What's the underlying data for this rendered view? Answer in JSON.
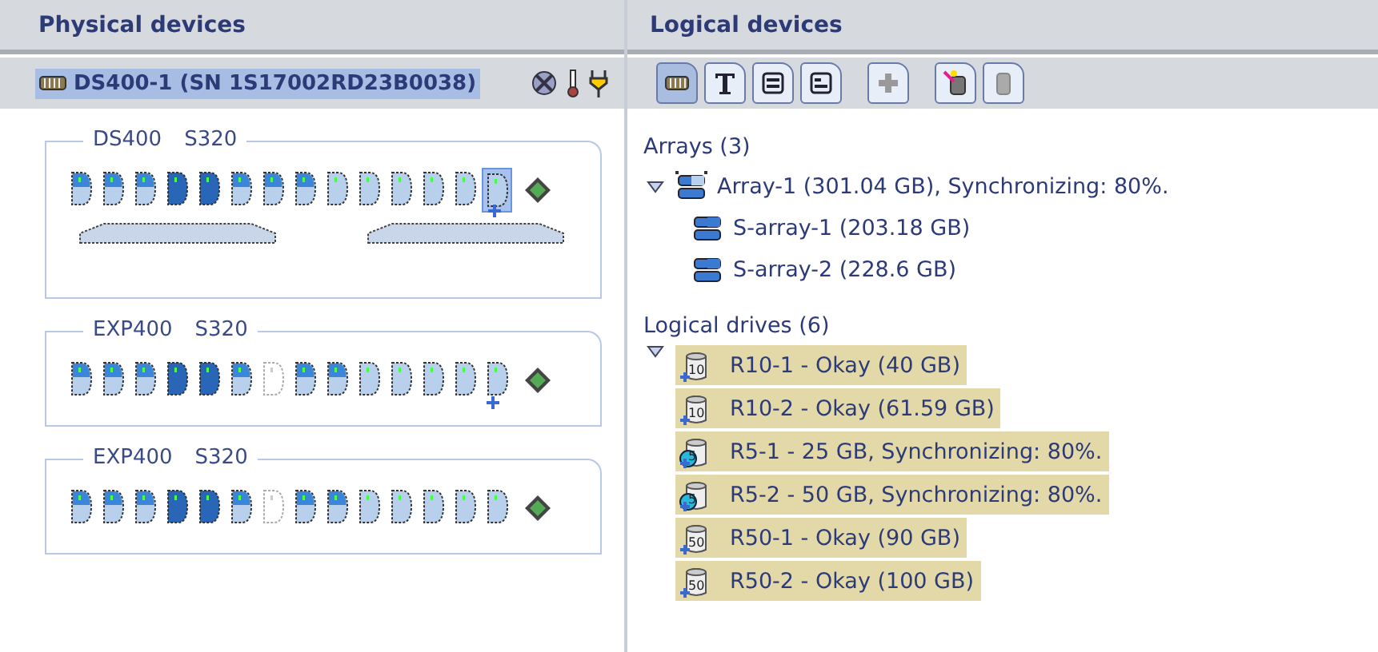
{
  "physical": {
    "title": "Physical devices",
    "device": {
      "label": "DS400-1 (SN 1S17002RD23B0038)",
      "selected": true
    },
    "enclosures": [
      {
        "model": "DS400",
        "controller": "S320",
        "controllers_bar": true,
        "disks": [
          {
            "kind": "partial",
            "selected": false,
            "spare": false
          },
          {
            "kind": "partial",
            "selected": false,
            "spare": false
          },
          {
            "kind": "partial",
            "selected": false,
            "spare": false
          },
          {
            "kind": "full",
            "selected": false,
            "spare": false
          },
          {
            "kind": "full",
            "selected": false,
            "spare": false
          },
          {
            "kind": "partial",
            "selected": false,
            "spare": false
          },
          {
            "kind": "partial",
            "selected": false,
            "spare": false
          },
          {
            "kind": "partial",
            "selected": false,
            "spare": false
          },
          {
            "kind": "free",
            "selected": false,
            "spare": false
          },
          {
            "kind": "free",
            "selected": false,
            "spare": false
          },
          {
            "kind": "free",
            "selected": false,
            "spare": false
          },
          {
            "kind": "free",
            "selected": false,
            "spare": false
          },
          {
            "kind": "free",
            "selected": false,
            "spare": false
          },
          {
            "kind": "free",
            "selected": true,
            "spare": true
          }
        ]
      },
      {
        "model": "EXP400",
        "controller": "S320",
        "controllers_bar": false,
        "disks": [
          {
            "kind": "partial",
            "selected": false,
            "spare": false
          },
          {
            "kind": "partial",
            "selected": false,
            "spare": false
          },
          {
            "kind": "partial",
            "selected": false,
            "spare": false
          },
          {
            "kind": "full",
            "selected": false,
            "spare": false
          },
          {
            "kind": "full",
            "selected": false,
            "spare": false
          },
          {
            "kind": "partial",
            "selected": false,
            "spare": false
          },
          {
            "kind": "absent",
            "selected": false,
            "spare": false
          },
          {
            "kind": "partial",
            "selected": false,
            "spare": false
          },
          {
            "kind": "partial",
            "selected": false,
            "spare": false
          },
          {
            "kind": "free",
            "selected": false,
            "spare": false
          },
          {
            "kind": "free",
            "selected": false,
            "spare": false
          },
          {
            "kind": "free",
            "selected": false,
            "spare": false
          },
          {
            "kind": "free",
            "selected": false,
            "spare": false
          },
          {
            "kind": "free",
            "selected": false,
            "spare": true
          }
        ]
      },
      {
        "model": "EXP400",
        "controller": "S320",
        "controllers_bar": false,
        "disks": [
          {
            "kind": "partial",
            "selected": false,
            "spare": false
          },
          {
            "kind": "partial",
            "selected": false,
            "spare": false
          },
          {
            "kind": "partial",
            "selected": false,
            "spare": false
          },
          {
            "kind": "full",
            "selected": false,
            "spare": false
          },
          {
            "kind": "full",
            "selected": false,
            "spare": false
          },
          {
            "kind": "partial",
            "selected": false,
            "spare": false
          },
          {
            "kind": "absent",
            "selected": false,
            "spare": false
          },
          {
            "kind": "partial",
            "selected": false,
            "spare": false
          },
          {
            "kind": "partial",
            "selected": false,
            "spare": false
          },
          {
            "kind": "free",
            "selected": false,
            "spare": false
          },
          {
            "kind": "free",
            "selected": false,
            "spare": false
          },
          {
            "kind": "free",
            "selected": false,
            "spare": false
          },
          {
            "kind": "free",
            "selected": false,
            "spare": false
          },
          {
            "kind": "free",
            "selected": false,
            "spare": false
          }
        ]
      }
    ]
  },
  "logical": {
    "title": "Logical devices",
    "toolbar": [
      {
        "kind": "enclosure",
        "selected": true
      },
      {
        "kind": "text",
        "selected": false
      },
      {
        "kind": "rows",
        "selected": false
      },
      {
        "kind": "split",
        "selected": false
      },
      {
        "kind": "add",
        "selected": false
      },
      {
        "kind": "wizard",
        "selected": false
      },
      {
        "kind": "remove",
        "selected": false
      }
    ],
    "arrays": {
      "label": "Arrays (3)",
      "expanded": true,
      "items": [
        {
          "label": "Array-1 (301.04 GB), Synchronizing: 80%.",
          "kind": "array",
          "children": [
            {
              "label": "S-array-1 (203.18 GB)",
              "kind": "sub"
            },
            {
              "label": "S-array-2 (228.6 GB)",
              "kind": "sub"
            }
          ]
        }
      ]
    },
    "drives": {
      "label": "Logical drives (6)",
      "expanded": true,
      "items": [
        {
          "label": "R10-1 - Okay (40 GB)",
          "level_badge": "10",
          "syncing": false,
          "selected": true
        },
        {
          "label": "R10-2 - Okay (61.59 GB)",
          "level_badge": "10",
          "syncing": false,
          "selected": true
        },
        {
          "label": "R5-1 - 25 GB, Synchronizing: 80%.",
          "level_badge": "5",
          "syncing": true,
          "selected": true
        },
        {
          "label": "R5-2 - 50 GB, Synchronizing: 80%.",
          "level_badge": "5",
          "syncing": true,
          "selected": true
        },
        {
          "label": "R50-1 - Okay (90 GB)",
          "level_badge": "50",
          "syncing": false,
          "selected": true
        },
        {
          "label": "R50-2 - Okay (100 GB)",
          "level_badge": "50",
          "syncing": false,
          "selected": true
        }
      ]
    }
  }
}
